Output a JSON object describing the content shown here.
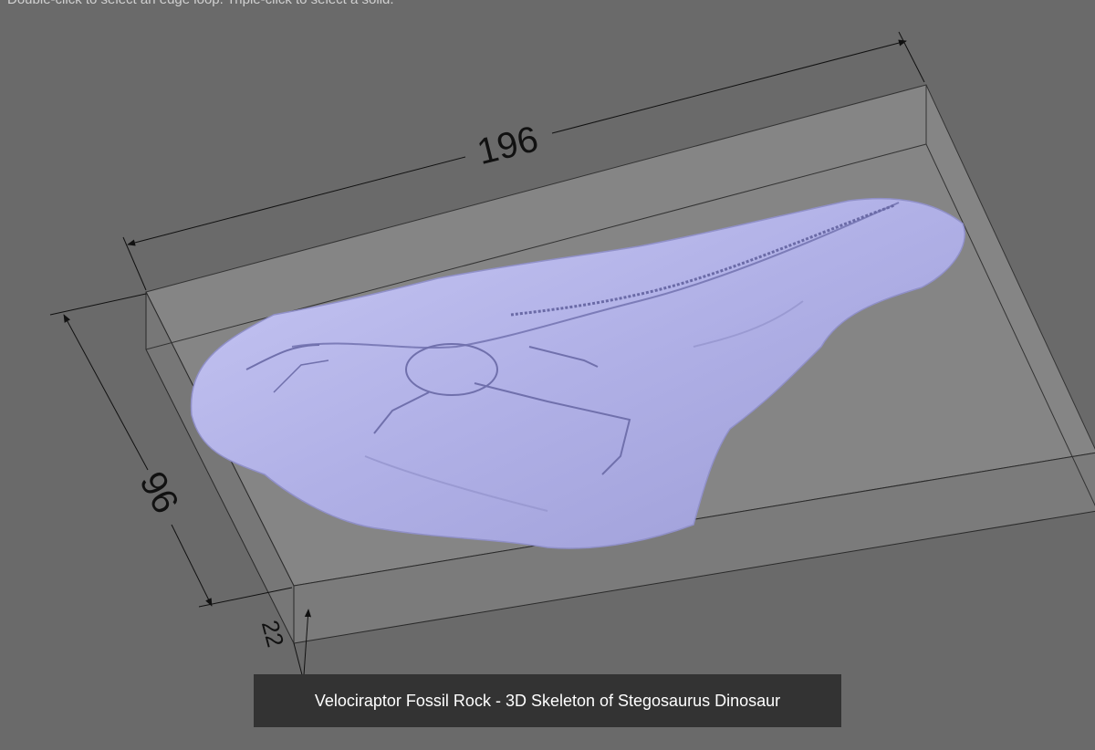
{
  "viewport": {
    "hint_text": "Double-click to select an edge loop. Triple-click to select a solid.",
    "caption": "Velociraptor Fossil Rock - 3D Skeleton of Stegosaurus Dinosaur",
    "background_color": "#6a6a6a",
    "model_color": "#b4b4ec"
  },
  "dimensions": {
    "length": "196",
    "width": "96",
    "height": "22"
  }
}
